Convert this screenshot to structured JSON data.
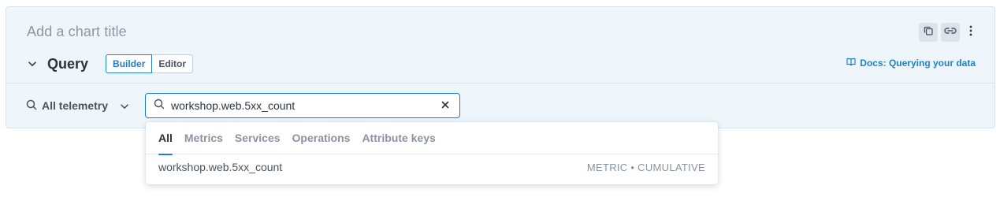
{
  "panel": {
    "chart_title_placeholder": "Add a chart title"
  },
  "top_actions": {
    "icons": [
      "copy-icon",
      "link-icon",
      "more-vertical-icon"
    ]
  },
  "query": {
    "label": "Query",
    "modes": [
      {
        "label": "Builder",
        "active": true
      },
      {
        "label": "Editor",
        "active": false
      }
    ],
    "docs_link": "Docs: Querying your data"
  },
  "telemetry": {
    "label": "All telemetry"
  },
  "search": {
    "value": "workshop.web.5xx_count"
  },
  "dropdown": {
    "tabs": [
      {
        "label": "All",
        "active": true
      },
      {
        "label": "Metrics",
        "active": false
      },
      {
        "label": "Services",
        "active": false
      },
      {
        "label": "Operations",
        "active": false
      },
      {
        "label": "Attribute keys",
        "active": false
      }
    ],
    "results": [
      {
        "name": "workshop.web.5xx_count",
        "meta": "METRIC • CUMULATIVE"
      }
    ]
  },
  "colors": {
    "accent": "#1f7fc4",
    "panel_bg": "#eef6fc"
  }
}
